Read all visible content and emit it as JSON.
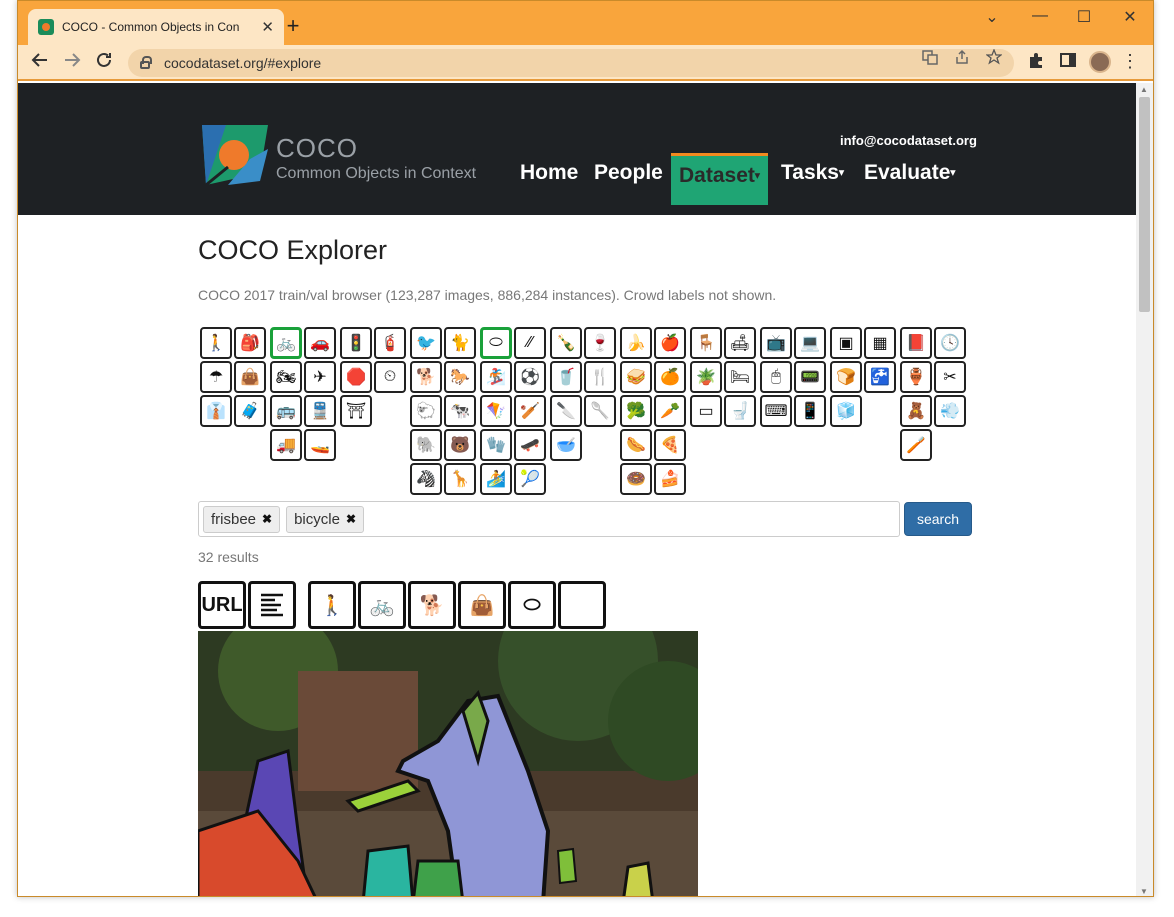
{
  "browser": {
    "tab_title": "COCO - Common Objects in Con",
    "tab_close": "✕",
    "new_tab": "+",
    "url": "cocodataset.org/#explore",
    "controls": {
      "minimize": "⌄",
      "restore": "—",
      "maximize": "☐",
      "close": "✕"
    }
  },
  "site": {
    "logo_title": "COCO",
    "logo_subtitle": "Common Objects in Context",
    "email": "info@cocodataset.org",
    "nav": [
      {
        "label": "Home",
        "caret": ""
      },
      {
        "label": "People",
        "caret": ""
      },
      {
        "label": "Dataset",
        "caret": "▾"
      },
      {
        "label": "Tasks",
        "caret": "▾"
      },
      {
        "label": "Evaluate",
        "caret": "▾"
      }
    ]
  },
  "explorer": {
    "title": "COCO Explorer",
    "subtitle": "COCO 2017 train/val browser (123,287 images, 886,284 instances). Crowd labels not shown.",
    "tags": [
      {
        "label": "frisbee",
        "remove": "✖"
      },
      {
        "label": "bicycle",
        "remove": "✖"
      }
    ],
    "search_label": "search",
    "results_text": "32 results",
    "tool_url_label": "URL"
  },
  "colors": {
    "header_bg": "#1e2124",
    "nav_active": "#1fa574",
    "nav_active_top": "#f28a1f",
    "selected_icon": "#1aa13a",
    "search_btn": "#2f6da6",
    "chrome_titlebar": "#f9a53c"
  }
}
